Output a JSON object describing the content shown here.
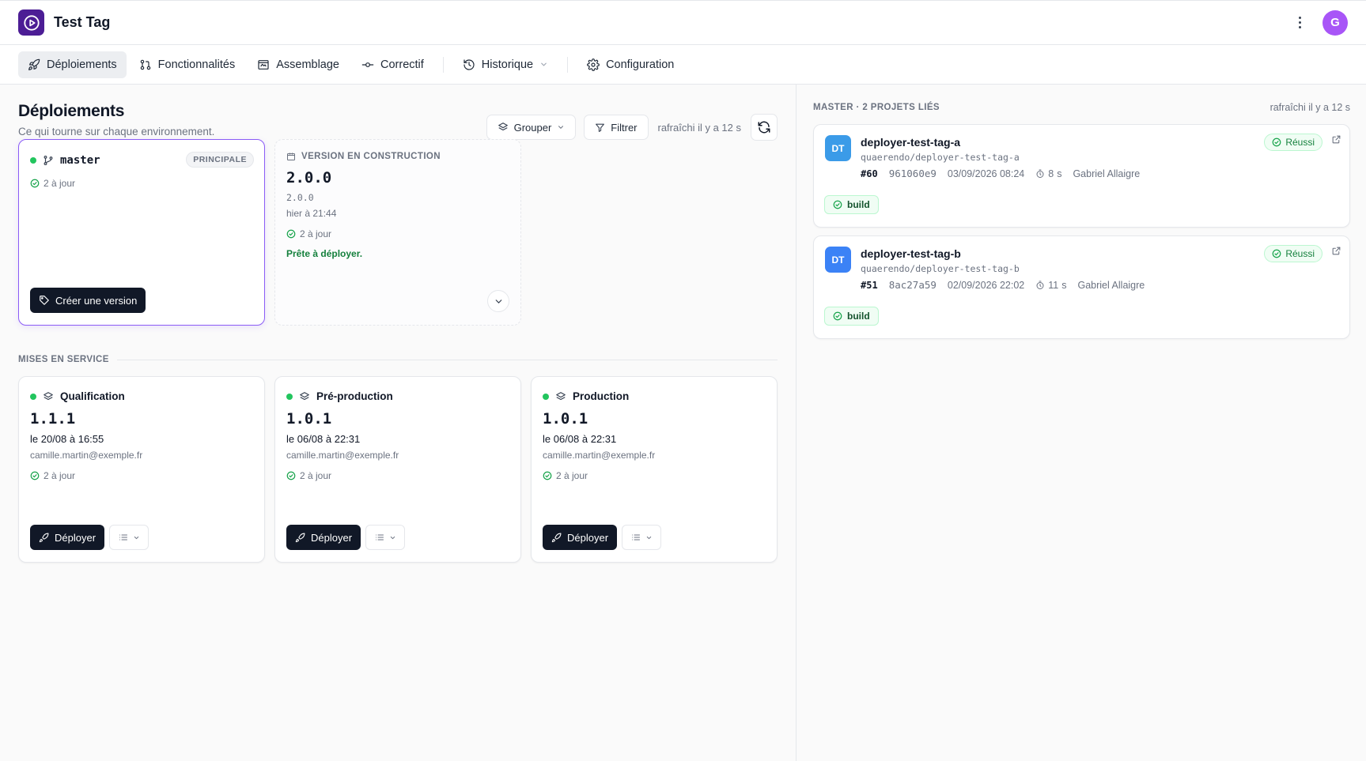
{
  "app": {
    "title": "Test Tag",
    "avatar_initial": "G"
  },
  "nav": {
    "tabs": [
      {
        "label": "Déploiements",
        "icon": "rocket-icon",
        "active": true
      },
      {
        "label": "Fonctionnalités",
        "icon": "git-pull-request-icon"
      },
      {
        "label": "Assemblage",
        "icon": "assembly-icon"
      },
      {
        "label": "Correctif",
        "icon": "commit-icon"
      },
      {
        "label": "Historique",
        "icon": "history-icon",
        "dropdown": true
      },
      {
        "label": "Configuration",
        "icon": "gear-icon"
      }
    ]
  },
  "main": {
    "title": "Déploiements",
    "subtitle": "Ce qui tourne sur chaque environnement.",
    "toolbar": {
      "group_label": "Grouper",
      "filter_label": "Filtrer",
      "refreshed": "rafraîchi il y a 12 s"
    },
    "branch_card": {
      "branch": "master",
      "badge": "PRINCIPALE",
      "status": "2 à jour",
      "create_label": "Créer une version"
    },
    "build_card": {
      "header": "VERSION EN CONSTRUCTION",
      "version": "2.0.0",
      "version_small": "2.0.0",
      "date": "hier à 21:44",
      "status": "2 à jour",
      "ready": "Prête à déployer."
    },
    "section_label": "MISES EN SERVICE",
    "environments": [
      {
        "name": "Qualification",
        "version": "1.1.1",
        "date": "le 20/08 à 16:55",
        "user": "camille.martin@exemple.fr",
        "status": "2 à jour",
        "deploy_label": "Déployer"
      },
      {
        "name": "Pré-production",
        "version": "1.0.1",
        "date": "le 06/08 à 22:31",
        "user": "camille.martin@exemple.fr",
        "status": "2 à jour",
        "deploy_label": "Déployer"
      },
      {
        "name": "Production",
        "version": "1.0.1",
        "date": "le 06/08 à 22:31",
        "user": "camille.martin@exemple.fr",
        "status": "2 à jour",
        "deploy_label": "Déployer"
      }
    ]
  },
  "side": {
    "header": "MASTER · 2 PROJETS LIÉS",
    "refreshed": "rafraîchi il y a 12 s",
    "projects": [
      {
        "initials": "DT",
        "color": "#3b9be8",
        "name": "deployer-test-tag-a",
        "path": "quaerendo/deployer-test-tag-a",
        "status": "Réussi",
        "run": "#60",
        "sha": "961060e9",
        "date": "03/09/2026 08:24",
        "duration_value": "8",
        "duration_unit": "s",
        "author": "Gabriel Allaigre",
        "job": "build"
      },
      {
        "initials": "DT",
        "color": "#3b82f6",
        "name": "deployer-test-tag-b",
        "path": "quaerendo/deployer-test-tag-b",
        "status": "Réussi",
        "run": "#51",
        "sha": "8ac27a59",
        "date": "02/09/2026 22:02",
        "duration_value": "11",
        "duration_unit": "s",
        "author": "Gabriel Allaigre",
        "job": "build"
      }
    ]
  },
  "colors": {
    "accent": "#8b5cf6",
    "success": "#22c55e",
    "dark": "#111827",
    "logo": "#4c1d95",
    "avatar": "#a855f7"
  }
}
